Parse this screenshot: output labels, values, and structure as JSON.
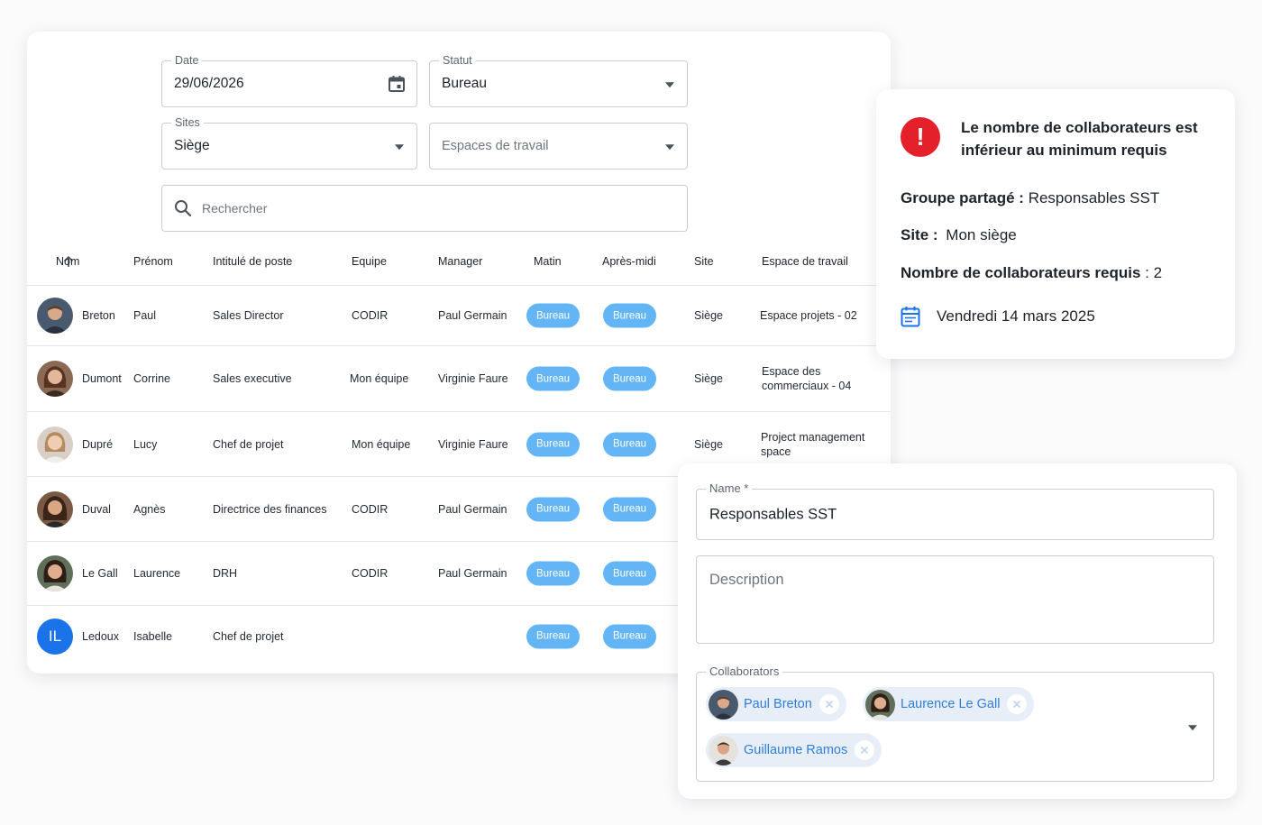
{
  "filters": {
    "date": {
      "label": "Date",
      "value": "29/06/2026"
    },
    "statut": {
      "label": "Statut",
      "value": "Bureau"
    },
    "sites": {
      "label": "Sites",
      "value": "Siège"
    },
    "espaces": {
      "placeholder": "Espaces de travail"
    },
    "search": {
      "placeholder": "Rechercher"
    }
  },
  "table": {
    "headers": {
      "nom": "Nom",
      "prenom": "Prénom",
      "intitule": "Intitulé de poste",
      "equipe": "Equipe",
      "manager": "Manager",
      "matin": "Matin",
      "apresmidi": "Après-midi",
      "site": "Site",
      "espace": "Espace de travail"
    },
    "rows": [
      {
        "nom": "Breton",
        "prenom": "Paul",
        "intitule": "Sales Director",
        "equipe": "CODIR",
        "manager": "Paul Germain",
        "matin": "Bureau",
        "apresmidi": "Bureau",
        "site": "Siège",
        "espace": "Espace projets - 02"
      },
      {
        "nom": "Dumont",
        "prenom": "Corrine",
        "intitule": "Sales executive",
        "equipe": "Mon équipe",
        "manager": "Virginie Faure",
        "matin": "Bureau",
        "apresmidi": "Bureau",
        "site": "Siège",
        "espace": "Espace des commerciaux - 04"
      },
      {
        "nom": "Dupré",
        "prenom": "Lucy",
        "intitule": "Chef de projet",
        "equipe": "Mon équipe",
        "manager": "Virginie Faure",
        "matin": "Bureau",
        "apresmidi": "Bureau",
        "site": "Siège",
        "espace": "Project management space"
      },
      {
        "nom": "Duval",
        "prenom": "Agnès",
        "intitule": "Directrice des finances",
        "equipe": "CODIR",
        "manager": "Paul Germain",
        "matin": "Bureau",
        "apresmidi": "Bureau",
        "site": "",
        "espace": ""
      },
      {
        "nom": "Le Gall",
        "prenom": "Laurence",
        "intitule": "DRH",
        "equipe": "CODIR",
        "manager": "Paul Germain",
        "matin": "Bureau",
        "apresmidi": "Bureau",
        "site": "",
        "espace": ""
      },
      {
        "nom": "Ledoux",
        "prenom": "Isabelle",
        "intitule": "Chef de projet",
        "equipe": "",
        "manager": "",
        "matin": "Bureau",
        "apresmidi": "Bureau",
        "site": "",
        "espace": "",
        "initials": "IL"
      }
    ]
  },
  "alert": {
    "title": "Le nombre de collaborateurs est inférieur au minimum requis",
    "groupe_label": "Groupe partagé :",
    "groupe_value": "Responsables SST",
    "site_label": "Site :",
    "site_value": "Mon siège",
    "nombre_label": "Nombre de collaborateurs requis",
    "nombre_value": ": 2",
    "date": "Vendredi 14 mars 2025"
  },
  "form": {
    "name_label": "Name *",
    "name_value": "Responsables SST",
    "description_placeholder": "Description",
    "collaborators_label": "Collaborators",
    "collaborators": [
      "Paul Breton",
      "Laurence Le Gall",
      "Guillaume Ramos"
    ]
  },
  "colors": {
    "accent": "#64b5f6",
    "alert_red": "#e4212b",
    "chip_text": "#2f7fd8",
    "chip_bg": "#e8eef8",
    "initials_bg": "#1a73e8"
  }
}
